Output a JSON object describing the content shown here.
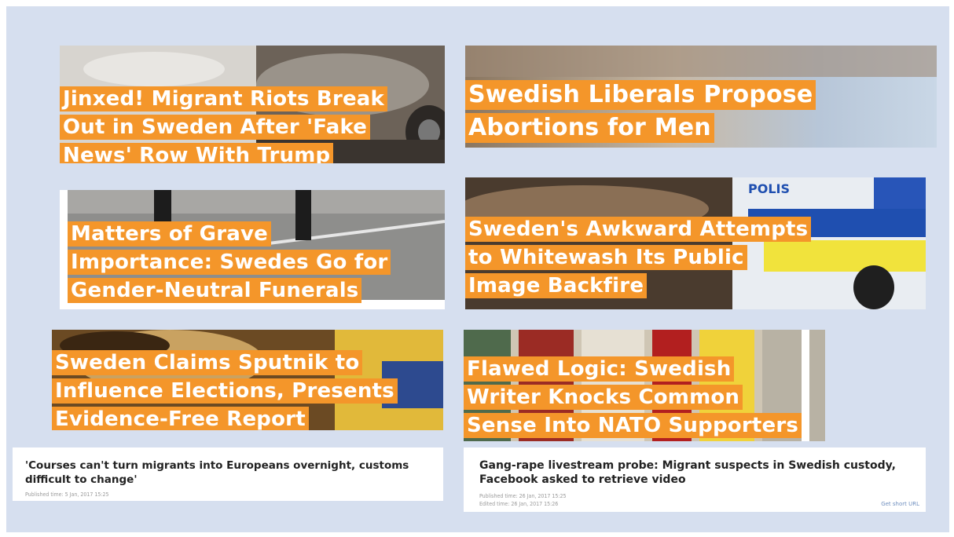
{
  "colors": {
    "page_background": "#d6dfef",
    "headline_highlight": "#f4962a",
    "headline_text": "#ffffff"
  },
  "tiles": [
    {
      "lines": [
        "Jinxed! Migrant Riots Break",
        "Out in Sweden After 'Fake",
        "News' Row With Trump"
      ]
    },
    {
      "lines": [
        "Swedish Liberals Propose",
        "Abortions for Men"
      ]
    },
    {
      "lines": [
        "Matters of Grave",
        "Importance: Swedes Go for",
        "Gender-Neutral Funerals"
      ]
    },
    {
      "lines": [
        "Sweden's Awkward Attempts",
        "to Whitewash Its Public",
        "Image Backfire"
      ],
      "van_label": "POLIS"
    },
    {
      "lines": [
        "Sweden Claims Sputnik to",
        "Influence Elections, Presents",
        "Evidence-Free Report"
      ]
    },
    {
      "lines": [
        "Flawed Logic: Swedish",
        "Writer Knocks Common",
        "Sense Into NATO Supporters"
      ]
    }
  ],
  "cards": [
    {
      "title_lines": [
        "'Courses can't turn migrants into Europeans overnight, customs",
        "difficult to change'"
      ],
      "published": "Published time: 5 Jan, 2017 15:25"
    },
    {
      "title_lines": [
        "Gang-rape livestream probe: Migrant suspects in Swedish custody,",
        "Facebook asked to retrieve video"
      ],
      "published": "Published time: 26 Jan, 2017 15:25",
      "edited": "Edited time: 26 Jan, 2017 15:26",
      "short_url_label": "Get short URL"
    }
  ]
}
